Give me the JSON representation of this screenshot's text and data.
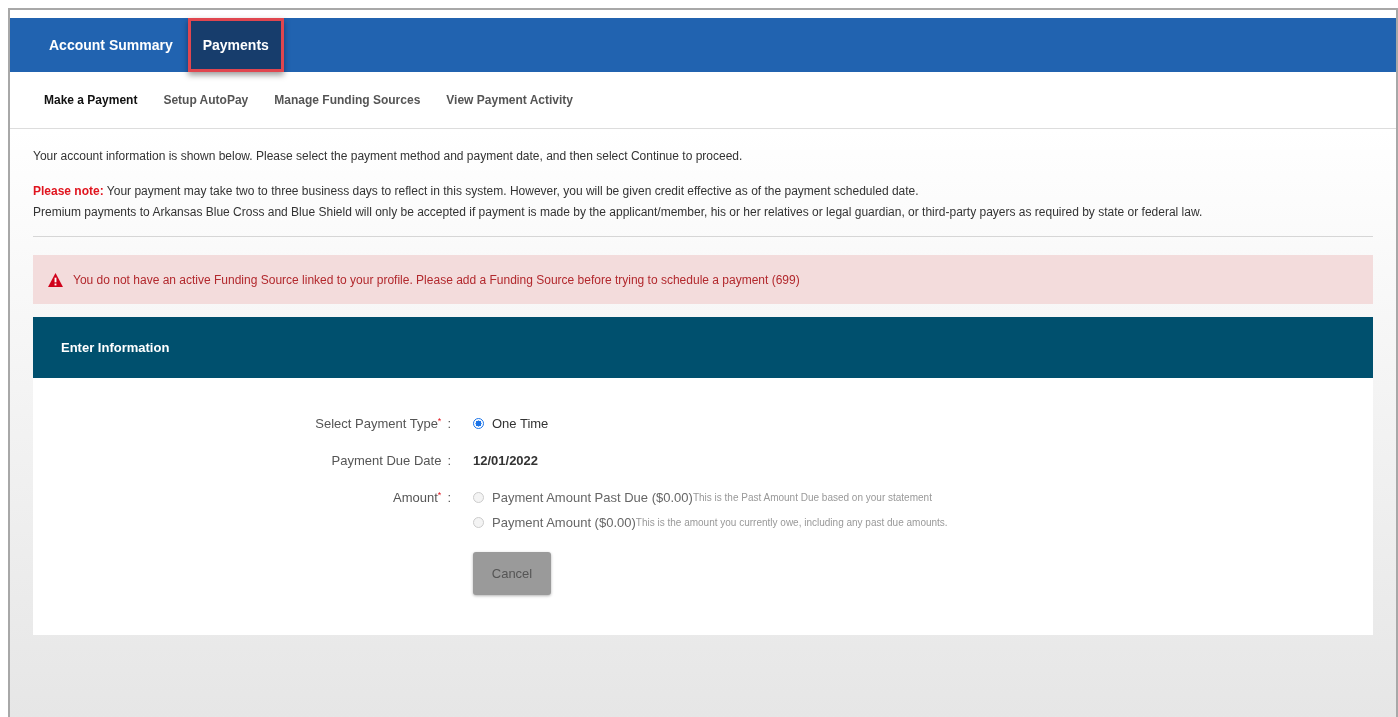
{
  "tabs": [
    {
      "label": "Account Summary",
      "selected": false,
      "highlighted": false
    },
    {
      "label": "Payments",
      "selected": true,
      "highlighted": true
    }
  ],
  "subnav": [
    {
      "label": "Make a Payment",
      "selected": true
    },
    {
      "label": "Setup AutoPay",
      "selected": false
    },
    {
      "label": "Manage Funding Sources",
      "selected": false
    },
    {
      "label": "View Payment Activity",
      "selected": false
    }
  ],
  "intro": "Your account information is shown below. Please select the payment method and payment date, and then select Continue to proceed.",
  "note": {
    "label": "Please note:",
    "text": "Your payment may take two to three business days to reflect in this system. However, you will be given credit effective as of the payment scheduled date.",
    "text_2": "Premium payments to Arkansas Blue Cross and Blue Shield will only be accepted if payment is made by the applicant/member, his or her relatives or legal guardian, or third-party payers as required by state or federal law."
  },
  "alert": {
    "message": "You do not have an active Funding Source linked to your profile. Please add a Funding Source before trying to schedule a payment (699)"
  },
  "form": {
    "title": "Enter Information",
    "rows": [
      {
        "kind": "radios",
        "label": "Select Payment Type",
        "required_mark": "*",
        "options": [
          {
            "label": "One Time",
            "selected": true,
            "disabled": false
          }
        ]
      },
      {
        "kind": "value",
        "label": "Payment Due Date",
        "value": "12/01/2022"
      },
      {
        "kind": "radios",
        "label": "Amount",
        "required_mark": "*",
        "options": [
          {
            "label": "Payment Amount Past Due ($0.00)",
            "hint": "This is the Past Amount Due based on your statement",
            "selected": false,
            "disabled": true
          },
          {
            "label": "Payment Amount ($0.00)",
            "hint": "This is the amount you currently owe, including any past due amounts.",
            "selected": false,
            "disabled": true
          }
        ]
      }
    ],
    "separator": ":",
    "button": {
      "label": "Cancel",
      "disabled": true
    }
  }
}
